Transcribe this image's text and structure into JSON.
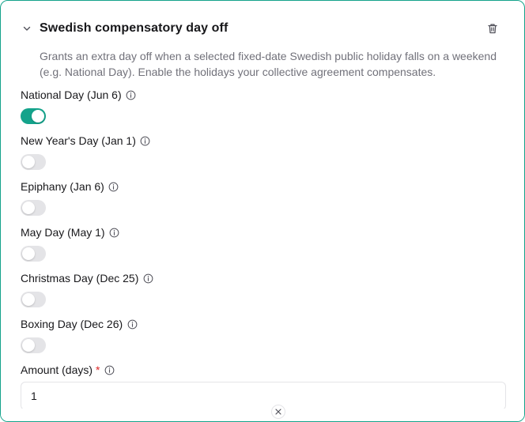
{
  "section": {
    "title": "Swedish compensatory day off",
    "description": "Grants an extra day off when a selected fixed-date Swedish public holiday falls on a weekend (e.g. National Day). Enable the holidays your collective agreement compensates."
  },
  "holidays": [
    {
      "label": "National Day (Jun 6)",
      "enabled": true
    },
    {
      "label": "New Year's Day (Jan 1)",
      "enabled": false
    },
    {
      "label": "Epiphany (Jan 6)",
      "enabled": false
    },
    {
      "label": "May Day (May 1)",
      "enabled": false
    },
    {
      "label": "Christmas Day (Dec 25)",
      "enabled": false
    },
    {
      "label": "Boxing Day (Dec 26)",
      "enabled": false
    }
  ],
  "amount": {
    "label": "Amount (days)",
    "required_mark": "*",
    "value": "1"
  },
  "colors": {
    "accent": "#14a38b",
    "switch_off": "#e4e4e7",
    "required": "#dc2626",
    "muted_text": "#71717a"
  },
  "icons": {
    "collapse": "chevron-down-icon",
    "delete": "trash-icon",
    "info": "info-icon",
    "close": "close-icon"
  }
}
